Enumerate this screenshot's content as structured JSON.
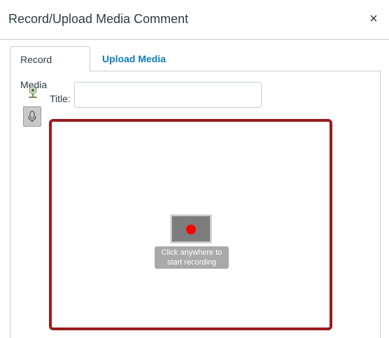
{
  "dialog": {
    "title": "Record/Upload Media Comment",
    "close_glyph": "×"
  },
  "tabs": [
    {
      "label": "Record Media",
      "active": true
    },
    {
      "label": "Upload Media",
      "active": false
    }
  ],
  "record_panel": {
    "title_label": "Title:",
    "title_value": "",
    "title_placeholder": "",
    "side_icons": [
      "webcam-icon",
      "microphone-icon"
    ],
    "record_button_icon": "record-dot-icon",
    "record_hint_line1": "Click anywhere to",
    "record_hint_line2": "start recording"
  },
  "colors": {
    "accent_link": "#0e7bbf",
    "recorder_border": "#9b1b1b",
    "record_dot": "#ff0000"
  }
}
